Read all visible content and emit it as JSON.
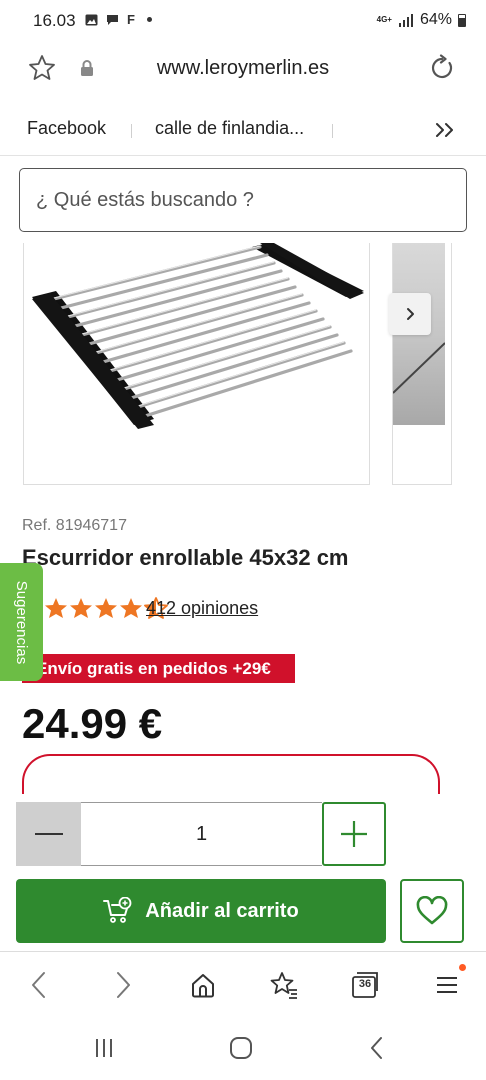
{
  "status_bar": {
    "time": "16.03",
    "notification_letter": "F",
    "network": "4G+",
    "battery": "64%"
  },
  "browser": {
    "url": "www.leroymerlin.es",
    "bookmarks": [
      "Facebook",
      "calle de finlandia..."
    ],
    "tab_count": "36"
  },
  "search": {
    "placeholder": "¿ Qué estás buscando ?"
  },
  "product": {
    "ref": "Ref. 81946717",
    "title": "Escurridor enrollable 45x32 cm",
    "rating": 4.5,
    "opinions": "412 opiniones",
    "shipping_badge": "Envío gratis en pedidos +29€",
    "price": "24.99 €",
    "quantity": "1"
  },
  "sidebar_tab": {
    "label": "Sugerencias"
  },
  "actions": {
    "add_to_cart": "Añadir al carrito"
  },
  "colors": {
    "brand_green": "#2f8a2f",
    "sugerencias_green": "#6cbd45",
    "badge_red": "#d0112b",
    "star_orange": "#ee7623"
  }
}
